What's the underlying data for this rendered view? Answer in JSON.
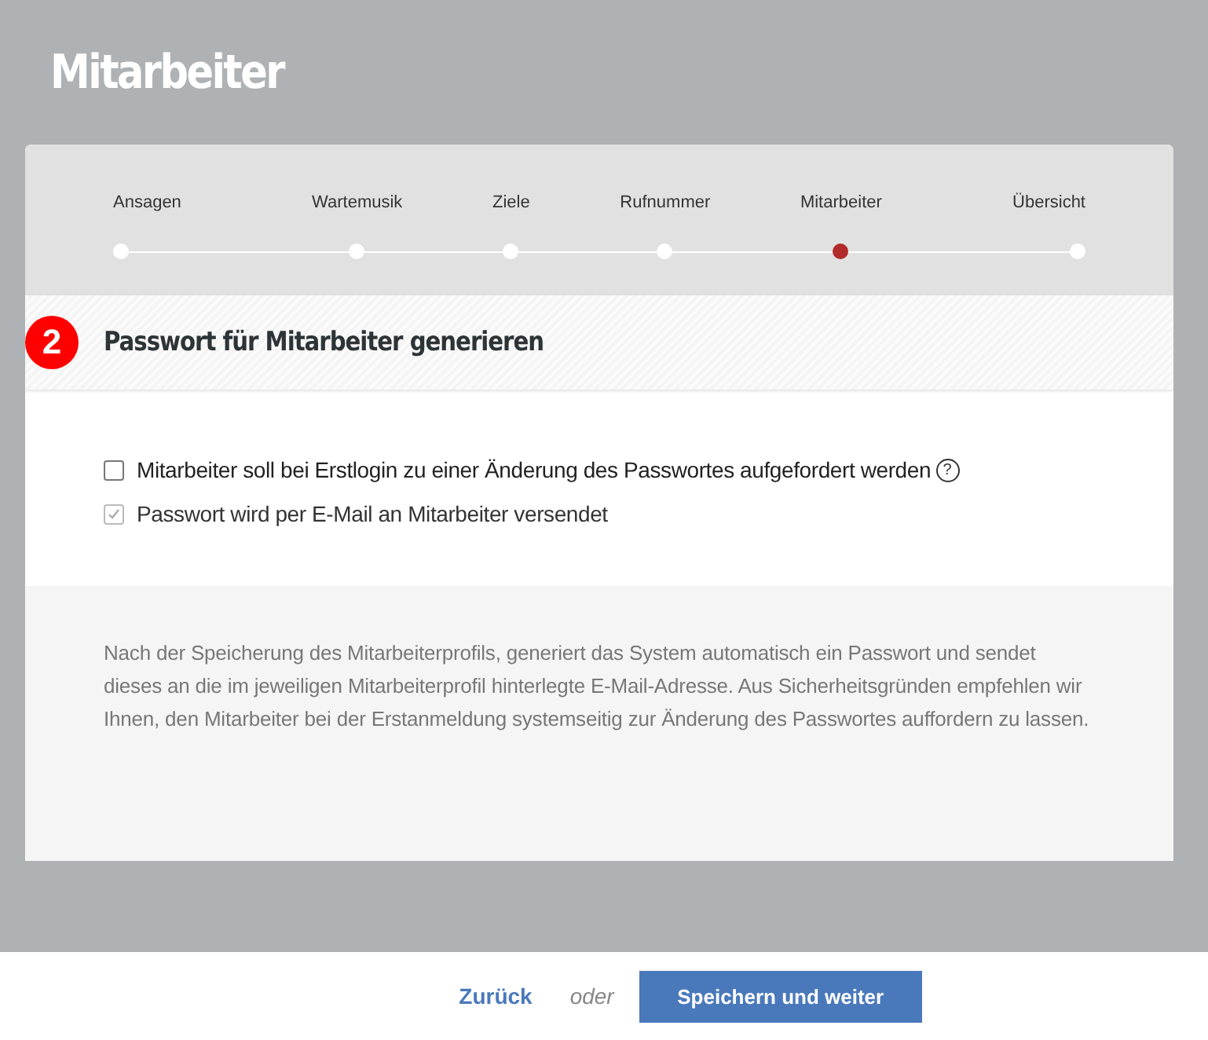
{
  "page": {
    "title": "Mitarbeiter"
  },
  "steps": [
    {
      "label": "Ansagen",
      "selected": false
    },
    {
      "label": "Wartemusik",
      "selected": false
    },
    {
      "label": "Ziele",
      "selected": false
    },
    {
      "label": "Rufnummer",
      "selected": false
    },
    {
      "label": "Mitarbeiter",
      "selected": true
    },
    {
      "label": "Übersicht",
      "selected": false
    }
  ],
  "section": {
    "number": "2",
    "title": "Passwort für Mitarbeiter generieren"
  },
  "options": [
    {
      "label": "Mitarbeiter soll bei Erstlogin zu einer Änderung des Passwortes aufgefordert werden",
      "checked": false,
      "disabled": false,
      "help": "?"
    },
    {
      "label": "Passwort wird per E-Mail an Mitarbeiter versendet",
      "checked": true,
      "disabled": true
    }
  ],
  "info": "Nach der Speicherung des Mitarbeiterprofils, generiert das System automatisch ein Passwort und sendet dieses an die im jeweiligen Mitarbeiterprofil hinterlegte E-Mail-Adresse. Aus Sicherheitsgründen empfehlen wir Ihnen, den Mitarbeiter bei der Erstanmeldung systemseitig zur Änderung des Passwortes auffordern zu lassen.",
  "footer": {
    "back": "Zurück",
    "or": "oder",
    "primary": "Speichern und weiter"
  }
}
